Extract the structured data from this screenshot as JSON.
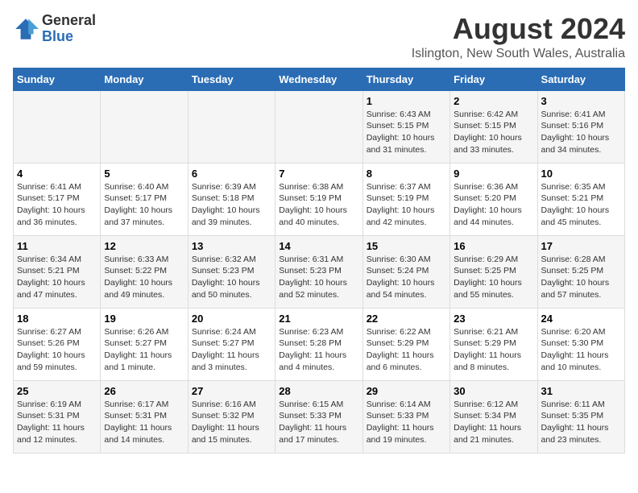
{
  "logo": {
    "general": "General",
    "blue": "Blue"
  },
  "title": "August 2024",
  "subtitle": "Islington, New South Wales, Australia",
  "days_of_week": [
    "Sunday",
    "Monday",
    "Tuesday",
    "Wednesday",
    "Thursday",
    "Friday",
    "Saturday"
  ],
  "weeks": [
    [
      {
        "num": "",
        "info": ""
      },
      {
        "num": "",
        "info": ""
      },
      {
        "num": "",
        "info": ""
      },
      {
        "num": "",
        "info": ""
      },
      {
        "num": "1",
        "info": "Sunrise: 6:43 AM\nSunset: 5:15 PM\nDaylight: 10 hours\nand 31 minutes."
      },
      {
        "num": "2",
        "info": "Sunrise: 6:42 AM\nSunset: 5:15 PM\nDaylight: 10 hours\nand 33 minutes."
      },
      {
        "num": "3",
        "info": "Sunrise: 6:41 AM\nSunset: 5:16 PM\nDaylight: 10 hours\nand 34 minutes."
      }
    ],
    [
      {
        "num": "4",
        "info": "Sunrise: 6:41 AM\nSunset: 5:17 PM\nDaylight: 10 hours\nand 36 minutes."
      },
      {
        "num": "5",
        "info": "Sunrise: 6:40 AM\nSunset: 5:17 PM\nDaylight: 10 hours\nand 37 minutes."
      },
      {
        "num": "6",
        "info": "Sunrise: 6:39 AM\nSunset: 5:18 PM\nDaylight: 10 hours\nand 39 minutes."
      },
      {
        "num": "7",
        "info": "Sunrise: 6:38 AM\nSunset: 5:19 PM\nDaylight: 10 hours\nand 40 minutes."
      },
      {
        "num": "8",
        "info": "Sunrise: 6:37 AM\nSunset: 5:19 PM\nDaylight: 10 hours\nand 42 minutes."
      },
      {
        "num": "9",
        "info": "Sunrise: 6:36 AM\nSunset: 5:20 PM\nDaylight: 10 hours\nand 44 minutes."
      },
      {
        "num": "10",
        "info": "Sunrise: 6:35 AM\nSunset: 5:21 PM\nDaylight: 10 hours\nand 45 minutes."
      }
    ],
    [
      {
        "num": "11",
        "info": "Sunrise: 6:34 AM\nSunset: 5:21 PM\nDaylight: 10 hours\nand 47 minutes."
      },
      {
        "num": "12",
        "info": "Sunrise: 6:33 AM\nSunset: 5:22 PM\nDaylight: 10 hours\nand 49 minutes."
      },
      {
        "num": "13",
        "info": "Sunrise: 6:32 AM\nSunset: 5:23 PM\nDaylight: 10 hours\nand 50 minutes."
      },
      {
        "num": "14",
        "info": "Sunrise: 6:31 AM\nSunset: 5:23 PM\nDaylight: 10 hours\nand 52 minutes."
      },
      {
        "num": "15",
        "info": "Sunrise: 6:30 AM\nSunset: 5:24 PM\nDaylight: 10 hours\nand 54 minutes."
      },
      {
        "num": "16",
        "info": "Sunrise: 6:29 AM\nSunset: 5:25 PM\nDaylight: 10 hours\nand 55 minutes."
      },
      {
        "num": "17",
        "info": "Sunrise: 6:28 AM\nSunset: 5:25 PM\nDaylight: 10 hours\nand 57 minutes."
      }
    ],
    [
      {
        "num": "18",
        "info": "Sunrise: 6:27 AM\nSunset: 5:26 PM\nDaylight: 10 hours\nand 59 minutes."
      },
      {
        "num": "19",
        "info": "Sunrise: 6:26 AM\nSunset: 5:27 PM\nDaylight: 11 hours\nand 1 minute."
      },
      {
        "num": "20",
        "info": "Sunrise: 6:24 AM\nSunset: 5:27 PM\nDaylight: 11 hours\nand 3 minutes."
      },
      {
        "num": "21",
        "info": "Sunrise: 6:23 AM\nSunset: 5:28 PM\nDaylight: 11 hours\nand 4 minutes."
      },
      {
        "num": "22",
        "info": "Sunrise: 6:22 AM\nSunset: 5:29 PM\nDaylight: 11 hours\nand 6 minutes."
      },
      {
        "num": "23",
        "info": "Sunrise: 6:21 AM\nSunset: 5:29 PM\nDaylight: 11 hours\nand 8 minutes."
      },
      {
        "num": "24",
        "info": "Sunrise: 6:20 AM\nSunset: 5:30 PM\nDaylight: 11 hours\nand 10 minutes."
      }
    ],
    [
      {
        "num": "25",
        "info": "Sunrise: 6:19 AM\nSunset: 5:31 PM\nDaylight: 11 hours\nand 12 minutes."
      },
      {
        "num": "26",
        "info": "Sunrise: 6:17 AM\nSunset: 5:31 PM\nDaylight: 11 hours\nand 14 minutes."
      },
      {
        "num": "27",
        "info": "Sunrise: 6:16 AM\nSunset: 5:32 PM\nDaylight: 11 hours\nand 15 minutes."
      },
      {
        "num": "28",
        "info": "Sunrise: 6:15 AM\nSunset: 5:33 PM\nDaylight: 11 hours\nand 17 minutes."
      },
      {
        "num": "29",
        "info": "Sunrise: 6:14 AM\nSunset: 5:33 PM\nDaylight: 11 hours\nand 19 minutes."
      },
      {
        "num": "30",
        "info": "Sunrise: 6:12 AM\nSunset: 5:34 PM\nDaylight: 11 hours\nand 21 minutes."
      },
      {
        "num": "31",
        "info": "Sunrise: 6:11 AM\nSunset: 5:35 PM\nDaylight: 11 hours\nand 23 minutes."
      }
    ]
  ]
}
